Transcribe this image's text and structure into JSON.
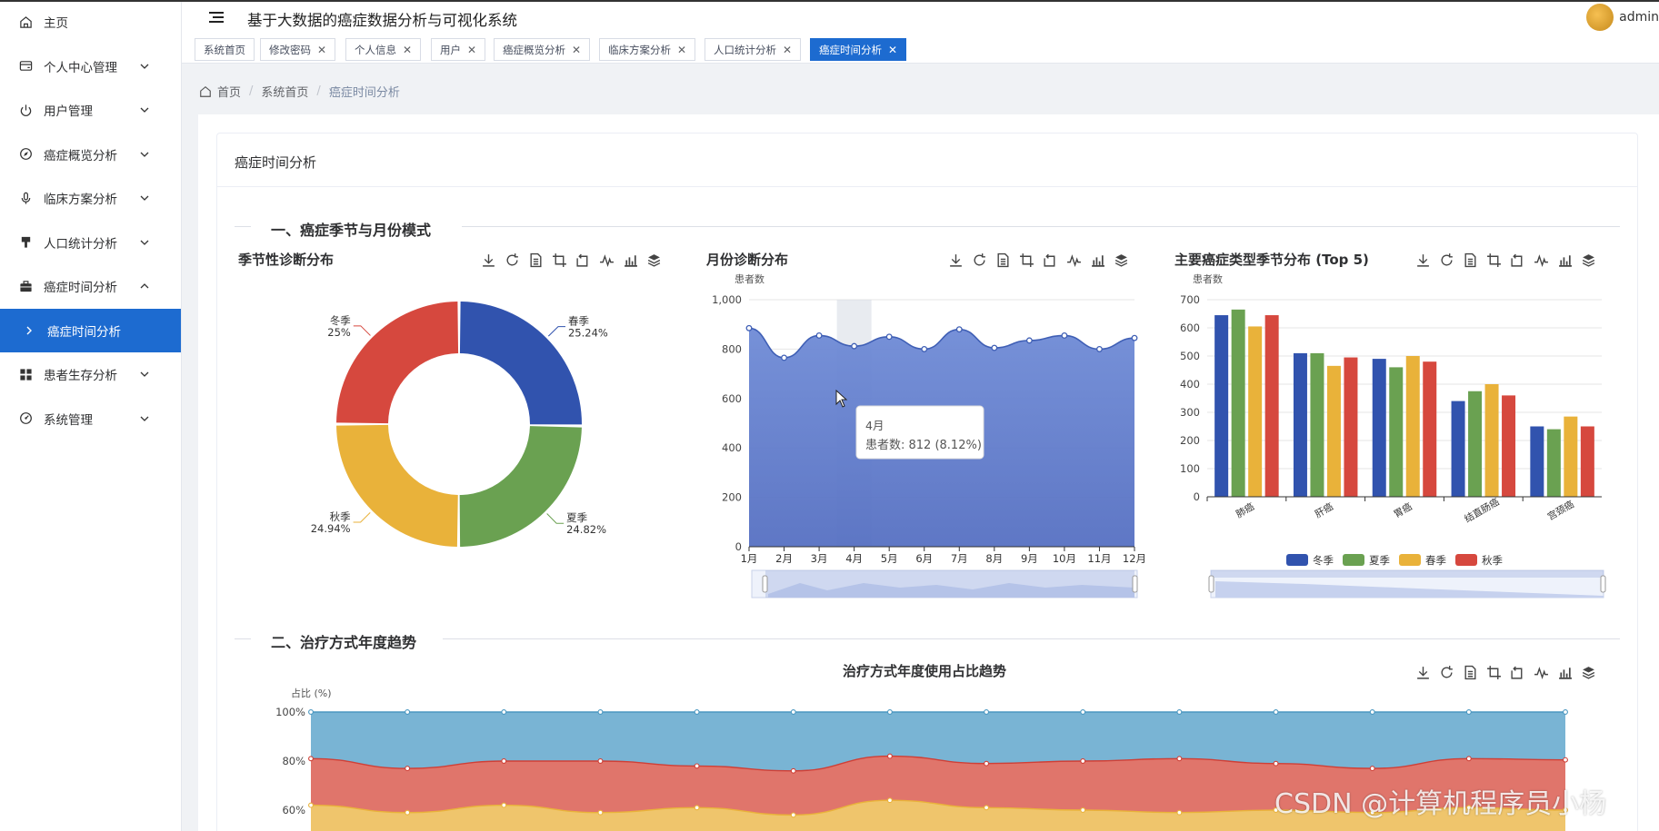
{
  "header": {
    "app_title": "基于大数据的癌症数据分析与可视化系统",
    "user_name": "admin"
  },
  "sidebar": {
    "items": [
      {
        "label": "主页",
        "icon": "home-icon"
      },
      {
        "label": "个人中心管理",
        "icon": "wallet-icon"
      },
      {
        "label": "用户管理",
        "icon": "power-icon"
      },
      {
        "label": "癌症概览分析",
        "icon": "compass-icon"
      },
      {
        "label": "临床方案分析",
        "icon": "microphone-icon"
      },
      {
        "label": "人口统计分析",
        "icon": "brush-icon"
      },
      {
        "label": "癌症时间分析",
        "icon": "briefcase-icon"
      },
      {
        "label": "癌症时间分析",
        "icon": "chevron-right-icon"
      },
      {
        "label": "患者生存分析",
        "icon": "grid-icon"
      },
      {
        "label": "系统管理",
        "icon": "gauge-icon"
      }
    ]
  },
  "tabs": [
    {
      "label": "系统首页",
      "closable": false
    },
    {
      "label": "修改密码",
      "closable": true
    },
    {
      "label": "个人信息",
      "closable": true
    },
    {
      "label": "用户",
      "closable": true
    },
    {
      "label": "癌症概览分析",
      "closable": true
    },
    {
      "label": "临床方案分析",
      "closable": true
    },
    {
      "label": "人口统计分析",
      "closable": true
    },
    {
      "label": "癌症时间分析",
      "closable": true,
      "active": true
    }
  ],
  "breadcrumb": {
    "home": "首页",
    "level1": "系统首页",
    "current": "癌症时间分析"
  },
  "page": {
    "card_title": "癌症时间分析",
    "section1": "一、癌症季节与月份模式",
    "section2": "二、治疗方式年度趋势"
  },
  "colors": {
    "primary": "#1d6bd0",
    "winter": "#3153ae",
    "summer": "#6aa151",
    "spring": "#e9b23a",
    "autumn": "#d6483e",
    "area_blue": "#5b78c8"
  },
  "chart_data": [
    {
      "type": "pie",
      "title": "季节性诊断分布",
      "labels": [
        "春季",
        "夏季",
        "秋季",
        "冬季"
      ],
      "values": [
        25.24,
        24.82,
        24.94,
        25.0
      ],
      "value_labels": [
        "25.24%",
        "24.82%",
        "24.94%",
        "25%"
      ]
    },
    {
      "type": "area",
      "title": "月份诊断分布",
      "ylabel": "患者数",
      "categories": [
        "1月",
        "2月",
        "3月",
        "4月",
        "5月",
        "6月",
        "7月",
        "8月",
        "9月",
        "10月",
        "11月",
        "12月"
      ],
      "values": [
        885,
        765,
        855,
        812,
        850,
        800,
        880,
        805,
        835,
        855,
        800,
        845
      ],
      "yticks": [
        "0",
        "200",
        "400",
        "600",
        "800",
        "1,000"
      ],
      "ylim": [
        0,
        1000
      ],
      "tooltip": {
        "title": "4月",
        "text": "患者数: 812 (8.12%)"
      }
    },
    {
      "type": "bar",
      "title": "主要癌症类型季节分布 (Top 5)",
      "ylabel": "患者数",
      "categories": [
        "肺癌",
        "肝癌",
        "胃癌",
        "结直肠癌",
        "宫颈癌"
      ],
      "series": [
        {
          "name": "冬季",
          "values": [
            645,
            510,
            490,
            340,
            250
          ]
        },
        {
          "name": "夏季",
          "values": [
            665,
            510,
            460,
            375,
            240
          ]
        },
        {
          "name": "春季",
          "values": [
            605,
            465,
            500,
            400,
            285
          ]
        },
        {
          "name": "秋季",
          "values": [
            645,
            495,
            480,
            360,
            250
          ]
        }
      ],
      "yticks": [
        "0",
        "100",
        "200",
        "300",
        "400",
        "500",
        "600",
        "700"
      ],
      "ylim": [
        0,
        700
      ]
    },
    {
      "type": "area",
      "title": "治疗方式年度使用占比趋势",
      "ylabel": "占比 (%)",
      "yticks": [
        "60%",
        "80%",
        "100%"
      ],
      "series": [
        {
          "name": "top",
          "values": [
            100,
            100,
            100,
            100,
            100,
            100,
            100,
            100,
            100,
            100,
            100,
            100,
            100,
            100
          ]
        },
        {
          "name": "red",
          "values": [
            81,
            77,
            80,
            80,
            78,
            76,
            82,
            79,
            80,
            81,
            79,
            77,
            81,
            80.5
          ]
        },
        {
          "name": "yellow",
          "values": [
            62,
            59,
            62,
            59,
            61,
            58,
            64,
            61,
            60,
            59,
            60,
            59,
            61,
            60
          ]
        }
      ]
    }
  ],
  "watermark": "CSDN @计算机程序员小杨"
}
